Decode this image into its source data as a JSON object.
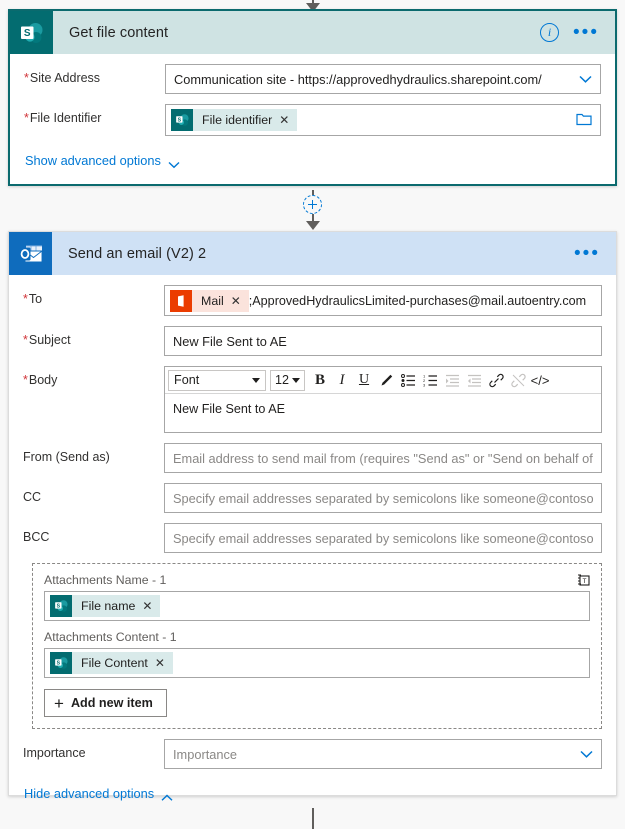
{
  "connectors": {
    "top_arrow_icon": "arrow-down-icon",
    "add_step_icon": "plus-circle-icon",
    "bottom_line_icon": "connector-line"
  },
  "cards": [
    {
      "id": "get-file-content",
      "title": "Get file content",
      "app_icon": "sharepoint-icon",
      "border_color": "#0b6a6e",
      "header_color": "#cfe3e3",
      "header_actions": {
        "info_icon": "info-icon",
        "menu_icon": "more-options-icon"
      },
      "fields": [
        {
          "label": "Site Address",
          "required": true,
          "type": "dropdown",
          "value": "Communication site - https://approvedhydraulics.sharepoint.com/"
        },
        {
          "label": "File Identifier",
          "required": true,
          "type": "token",
          "token": {
            "label": "File identifier",
            "icon": "sharepoint-icon",
            "remove_icon": "close-icon"
          },
          "value": "",
          "trailing_icon": "folder-icon"
        }
      ],
      "advanced_link": {
        "label": "Show advanced options",
        "chevron": "chevron-down-icon"
      }
    },
    {
      "id": "send-an-email-v2-2",
      "title": "Send an email (V2) 2",
      "app_icon": "outlook-icon",
      "border_color": "#dcdcdc",
      "header_color": "#cfe1f5",
      "header_actions": {
        "menu_icon": "more-options-icon"
      },
      "fields": [
        {
          "label": "To",
          "required": true,
          "type": "token-text",
          "token": {
            "label": "Mail",
            "icon": "office-mail-icon",
            "remove_icon": "close-icon"
          },
          "value": ";ApprovedHydraulicsLimited-purchases@mail.autoentry.com"
        },
        {
          "label": "Subject",
          "required": true,
          "type": "text",
          "value": "New File Sent to AE"
        },
        {
          "label": "Body",
          "required": true,
          "type": "richtext",
          "value": "New File Sent to AE"
        },
        {
          "label": "From (Send as)",
          "required": false,
          "type": "text",
          "value": "",
          "placeholder": "Email address to send mail from (requires \"Send as\" or \"Send on behalf of\" permissions)"
        },
        {
          "label": "CC",
          "required": false,
          "type": "text",
          "value": "",
          "placeholder": "Specify email addresses separated by semicolons like someone@contoso.com"
        },
        {
          "label": "BCC",
          "required": false,
          "type": "text",
          "value": "",
          "placeholder": "Specify email addresses separated by semicolons like someone@contoso.com"
        }
      ],
      "rich_text_toolbar": {
        "font_label": "Font",
        "font_size": "12",
        "buttons": [
          {
            "name": "bold-icon",
            "glyph": "B",
            "enabled": true
          },
          {
            "name": "italic-icon",
            "glyph": "I",
            "enabled": true
          },
          {
            "name": "underline-icon",
            "glyph": "U",
            "enabled": true
          },
          {
            "name": "highlight-pen-icon",
            "glyph": "",
            "enabled": true
          },
          {
            "name": "bulleted-list-icon",
            "glyph": "",
            "enabled": true
          },
          {
            "name": "numbered-list-icon",
            "glyph": "",
            "enabled": true
          },
          {
            "name": "decrease-indent-icon",
            "glyph": "",
            "enabled": false
          },
          {
            "name": "increase-indent-icon",
            "glyph": "",
            "enabled": false
          },
          {
            "name": "link-icon",
            "glyph": "",
            "enabled": true
          },
          {
            "name": "unlink-icon",
            "glyph": "",
            "enabled": false
          },
          {
            "name": "code-view-icon",
            "glyph": "</>",
            "enabled": true
          }
        ]
      },
      "attachments": {
        "delete_icon": "delete-icon",
        "items": [
          {
            "label": "Attachments Name - 1",
            "token": {
              "label": "File name",
              "icon": "sharepoint-icon",
              "remove_icon": "close-icon"
            }
          },
          {
            "label": "Attachments Content - 1",
            "token": {
              "label": "File Content",
              "icon": "sharepoint-icon",
              "remove_icon": "close-icon"
            }
          }
        ],
        "add_button": {
          "label": "Add new item",
          "icon": "plus-icon"
        }
      },
      "importance": {
        "label": "Importance",
        "placeholder": "Importance",
        "chevron": "chevron-down-icon"
      },
      "advanced_link": {
        "label": "Hide advanced options",
        "chevron": "chevron-up-icon"
      }
    }
  ]
}
